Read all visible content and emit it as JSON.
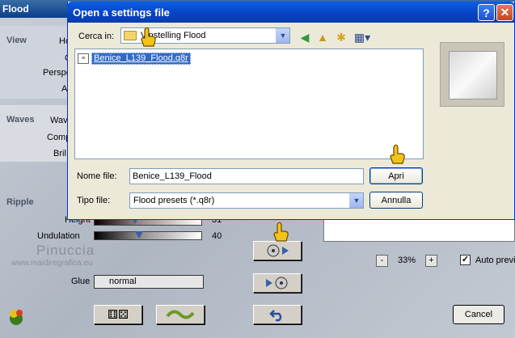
{
  "plugin": {
    "title": "Flood",
    "sections": {
      "view": "View",
      "waves": "Waves",
      "ripple": "Ripple"
    },
    "params": {
      "view_ho": "Ho",
      "view_c": "C",
      "view_perspe": "Perspe",
      "view_a": "A",
      "waves_wav": "Wav",
      "waves_comp": "Comp",
      "waves_bril": "Bril",
      "ripple_height": "Height",
      "ripple_height_value": "31",
      "ripple_undulation": "Undulation",
      "ripple_undulation_value": "40",
      "glue_label": "Glue",
      "glue_value": "normal"
    },
    "watermark": {
      "name": "Pinuccia",
      "url": "www.maidiregrafica.eu"
    },
    "zoom": {
      "minus": "-",
      "value": "33%",
      "plus": "+"
    },
    "auto_preview_label": "Auto previ",
    "auto_preview_checked": "✓",
    "cancel_label": "Cancel"
  },
  "dialog": {
    "title": "Open a settings file",
    "help_glyph": "?",
    "close_glyph": "✕",
    "look_in_label": "Cerca in:",
    "look_in_value": "Vinstelling Flood",
    "files": [
      {
        "name": "Benice_L139_Flood.q8r"
      }
    ],
    "file_name_label": "Nome file:",
    "file_name_value": "Benice_L139_Flood",
    "file_type_label": "Tipo file:",
    "file_type_value": "Flood presets (*.q8r)",
    "open_label": "Apri",
    "cancel_label": "Annulla"
  },
  "colors": {
    "dialog_titlebar": "#0a5ee6",
    "selection": "#316ac5",
    "dialog_face": "#ece9d8"
  }
}
